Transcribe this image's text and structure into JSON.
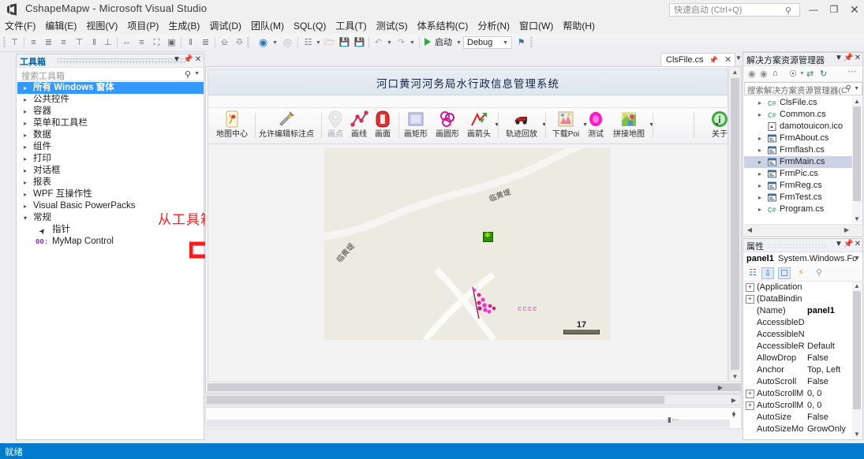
{
  "window": {
    "title": "CshapeMapw - Microsoft Visual Studio",
    "logo_icon": "visual-studio-logo",
    "quick_launch_placeholder": "快速启动 (Ctrl+Q)",
    "search_icon": "search-icon",
    "minimize_icon": "—",
    "maximize_icon": "❐",
    "close_icon": "✕"
  },
  "menubar": {
    "items": [
      {
        "label": "文件(F)"
      },
      {
        "label": "编辑(E)"
      },
      {
        "label": "视图(V)"
      },
      {
        "label": "项目(P)"
      },
      {
        "label": "生成(B)"
      },
      {
        "label": "调试(D)"
      },
      {
        "label": "团队(M)"
      },
      {
        "label": "SQL(Q)"
      },
      {
        "label": "工具(T)"
      },
      {
        "label": "测试(S)"
      },
      {
        "label": "体系结构(C)"
      },
      {
        "label": "分析(N)"
      },
      {
        "label": "窗口(W)"
      },
      {
        "label": "帮助(H)"
      }
    ]
  },
  "main_toolbar": {
    "start_label": "启动",
    "config_value": "Debug",
    "play_icon": "play-triangle-icon",
    "icons": [
      "align-top-icon",
      "align-left-icon",
      "align-center-icon",
      "align-right-icon",
      "align-tops-icon",
      "align-middles-icon",
      "align-bottoms-icon",
      "make-same-width-icon",
      "make-same-height-icon",
      "make-same-size-icon",
      "size-to-grid-icon",
      "horizontal-spacing-icon",
      "vertical-spacing-icon",
      "bring-to-front-icon",
      "send-to-back-icon",
      "navigate-backward-icon",
      "navigate-forward-icon",
      "new-project-icon",
      "open-file-icon",
      "save-icon",
      "save-all-icon",
      "undo-icon",
      "redo-icon",
      "attach-icon"
    ]
  },
  "toolbox": {
    "title": "工具箱",
    "search_placeholder": "搜索工具箱",
    "search_icon": "search-icon",
    "dropdown_icon": "chevron-down-icon",
    "pin_icon": "pin-icon",
    "close_icon": "close-icon",
    "items": [
      {
        "label": "所有 Windows 窗体",
        "state": "collapsed",
        "selected": true
      },
      {
        "label": "公共控件",
        "state": "collapsed",
        "selected": false
      },
      {
        "label": "容器",
        "state": "collapsed",
        "selected": false
      },
      {
        "label": "菜单和工具栏",
        "state": "collapsed",
        "selected": false
      },
      {
        "label": "数据",
        "state": "collapsed",
        "selected": false
      },
      {
        "label": "组件",
        "state": "collapsed",
        "selected": false
      },
      {
        "label": "打印",
        "state": "collapsed",
        "selected": false
      },
      {
        "label": "对话框",
        "state": "collapsed",
        "selected": false
      },
      {
        "label": "报表",
        "state": "collapsed",
        "selected": false
      },
      {
        "label": "WPF 互操作性",
        "state": "collapsed",
        "selected": false
      },
      {
        "label": "Visual Basic PowerPacks",
        "state": "collapsed",
        "selected": false
      },
      {
        "label": "常规",
        "state": "expanded",
        "selected": false
      }
    ],
    "children": [
      {
        "label": "指针",
        "icon": "pointer-icon"
      },
      {
        "label": "MyMap Control",
        "icon": "custom-control-icon"
      }
    ]
  },
  "annotation": {
    "text": "从工具箱里拖拽到窗体上",
    "arrow_icon": "right-arrow-annotation",
    "color": "#ff2020"
  },
  "document": {
    "tab_label": "ClsFile.cs",
    "pin_icon": "pin-icon",
    "close_icon": "close-icon",
    "chevron_icon": "chevron-down-icon"
  },
  "form_designer": {
    "title": "河口黄河河务局水行政信息管理系统",
    "toolbar_buttons": [
      {
        "label": "地图中心",
        "icon": "map-center-icon",
        "dropdown": false
      },
      {
        "label": "允许编辑标注点",
        "icon": "edit-marker-icon",
        "dropdown": false
      },
      {
        "label": "画点",
        "icon": "draw-point-icon",
        "dropdown": false,
        "disabled": true
      },
      {
        "label": "画线",
        "icon": "draw-line-icon",
        "dropdown": false
      },
      {
        "label": "画面",
        "icon": "draw-polygon-icon",
        "dropdown": false
      },
      {
        "label": "画矩形",
        "icon": "draw-rectangle-icon",
        "dropdown": false
      },
      {
        "label": "画圆形",
        "icon": "draw-circle-icon",
        "dropdown": false
      },
      {
        "label": "画箭头",
        "icon": "draw-arrow-icon",
        "dropdown": true
      },
      {
        "label": "轨迹回放",
        "icon": "track-playback-icon",
        "dropdown": true
      },
      {
        "label": "下载Poi",
        "icon": "download-poi-icon",
        "dropdown": true
      },
      {
        "label": "测试",
        "icon": "test-icon",
        "dropdown": false
      },
      {
        "label": "拼接地图",
        "icon": "stitch-map-icon",
        "dropdown": true
      },
      {
        "label": "关于",
        "icon": "about-icon",
        "dropdown": false
      }
    ],
    "map": {
      "scale_value": "17",
      "road_labels": [
        "临黄堤",
        "临黄堤"
      ],
      "marker_green_icon": "green-flower-marker",
      "cluster_label": "cccc",
      "cluster_icon": "magenta-cluster-marker",
      "background_color": "#eceae1"
    }
  },
  "solution_explorer": {
    "title": "解决方案资源管理器",
    "search_placeholder": "搜索解决方案资源管理器(C",
    "search_icon": "search-icon",
    "toolbar_icons": [
      "back-icon",
      "forward-icon",
      "home-icon",
      "pending-changes-icon",
      "sync-icon",
      "refresh-icon",
      "overflow-icon"
    ],
    "dropdown_icon": "chevron-down-icon",
    "pin_icon": "pin-icon",
    "close_icon": "close-icon",
    "files": [
      {
        "label": "ClsFile.cs",
        "icon": "csharp-file-icon",
        "expandable": true,
        "selected": false
      },
      {
        "label": "Common.cs",
        "icon": "csharp-file-icon",
        "expandable": true,
        "selected": false
      },
      {
        "label": "damotouicon.ico",
        "icon": "icon-file-icon",
        "expandable": false,
        "selected": false
      },
      {
        "label": "FrmAbout.cs",
        "icon": "form-file-icon",
        "expandable": true,
        "selected": false
      },
      {
        "label": "Frmflash.cs",
        "icon": "form-file-icon",
        "expandable": true,
        "selected": false
      },
      {
        "label": "FrmMain.cs",
        "icon": "form-file-icon",
        "expandable": true,
        "selected": true
      },
      {
        "label": "FrmPic.cs",
        "icon": "form-file-icon",
        "expandable": true,
        "selected": false
      },
      {
        "label": "FrmReg.cs",
        "icon": "form-file-icon",
        "expandable": true,
        "selected": false
      },
      {
        "label": "FrmTest.cs",
        "icon": "form-file-icon",
        "expandable": true,
        "selected": false
      },
      {
        "label": "Program.cs",
        "icon": "csharp-file-icon",
        "expandable": true,
        "selected": false
      }
    ]
  },
  "properties": {
    "title": "属性",
    "object_name": "panel1",
    "object_type": "System.Windows.Fo",
    "dropdown_icon": "chevron-down-icon",
    "pin_icon": "pin-icon",
    "close_icon": "close-icon",
    "toolbar_icons": [
      "categorized-icon",
      "alphabetical-icon",
      "properties-icon",
      "events-icon",
      "property-pages-icon"
    ],
    "rows": [
      {
        "name": "(Application",
        "value": "",
        "expandable": true
      },
      {
        "name": "(DataBindin",
        "value": "",
        "expandable": true
      },
      {
        "name": "(Name)",
        "value": "panel1",
        "expandable": false,
        "bold": true
      },
      {
        "name": "AccessibleD",
        "value": "",
        "expandable": false
      },
      {
        "name": "AccessibleN",
        "value": "",
        "expandable": false
      },
      {
        "name": "AccessibleR",
        "value": "Default",
        "expandable": false
      },
      {
        "name": "AllowDrop",
        "value": "False",
        "expandable": false
      },
      {
        "name": "Anchor",
        "value": "Top, Left",
        "expandable": false
      },
      {
        "name": "AutoScroll",
        "value": "False",
        "expandable": false
      },
      {
        "name": "AutoScrollM",
        "value": "0, 0",
        "expandable": true
      },
      {
        "name": "AutoScrollM",
        "value": "0, 0",
        "expandable": true
      },
      {
        "name": "AutoSize",
        "value": "False",
        "expandable": false
      },
      {
        "name": "AutoSizeMo",
        "value": "GrowOnly",
        "expandable": false
      }
    ]
  },
  "statusbar": {
    "text": "就绪",
    "color": "#007acc"
  }
}
